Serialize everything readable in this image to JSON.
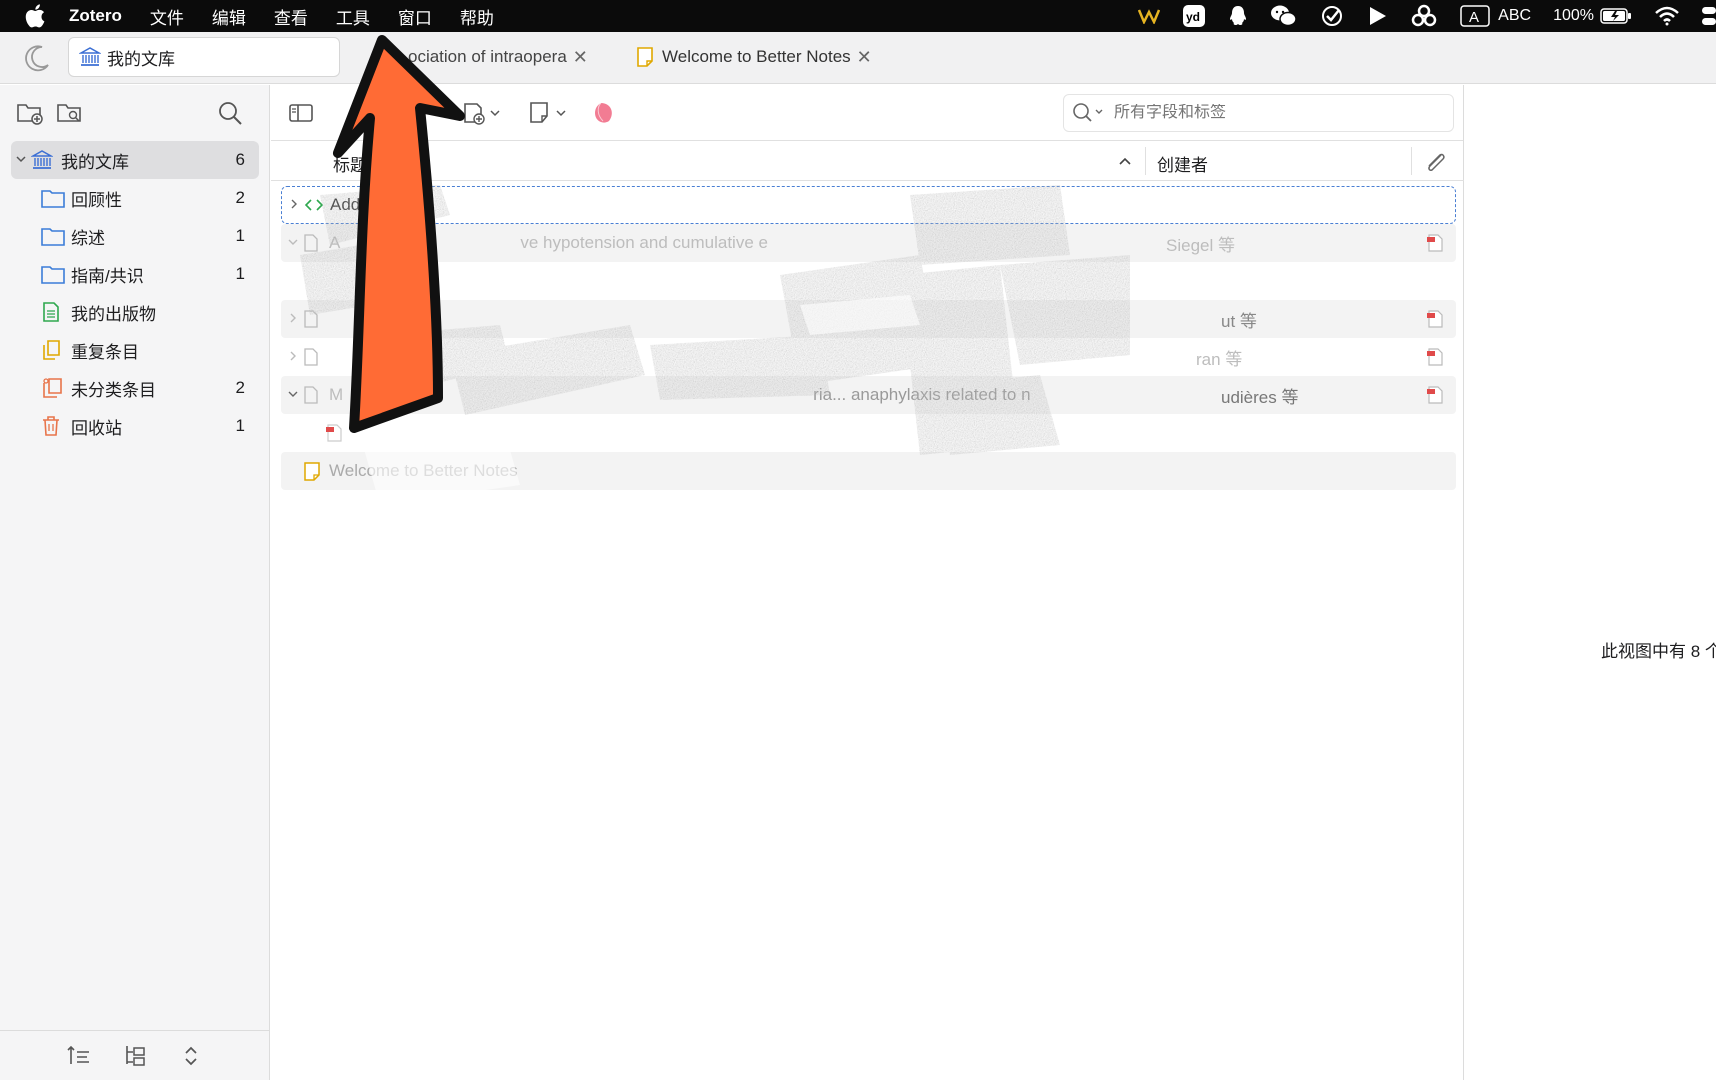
{
  "menubar": {
    "app_name": "Zotero",
    "menus": [
      "文件",
      "编辑",
      "查看",
      "工具",
      "窗口",
      "帮助"
    ],
    "input_source": "ABC",
    "battery": "100%"
  },
  "tabs": {
    "library_tab": "我的文库",
    "tab2": "ociation of intraopera",
    "tab3": "Welcome to Better Notes"
  },
  "sidebar": {
    "items": [
      {
        "label": "我的文库",
        "count": "6",
        "icon": "library-icon"
      },
      {
        "label": "回顾性",
        "count": "2",
        "icon": "folder-icon"
      },
      {
        "label": "综述",
        "count": "1",
        "icon": "folder-icon"
      },
      {
        "label": "指南/共识",
        "count": "1",
        "icon": "folder-icon"
      },
      {
        "label": "我的出版物",
        "count": "",
        "icon": "publications-icon"
      },
      {
        "label": "重复条目",
        "count": "",
        "icon": "duplicates-icon"
      },
      {
        "label": "未分类条目",
        "count": "2",
        "icon": "unfiled-icon"
      },
      {
        "label": "回收站",
        "count": "1",
        "icon": "trash-icon"
      }
    ]
  },
  "search": {
    "placeholder": "所有字段和标签"
  },
  "columns": {
    "title": "标题",
    "creator": "创建者"
  },
  "rows": [
    {
      "title": "Addo",
      "creator": ""
    },
    {
      "title": "A",
      "title_tail": "ve hypotension and cumulative e",
      "creator": "Siegel 等"
    },
    {
      "title": "",
      "creator": ""
    },
    {
      "title": "",
      "creator": "ut 等"
    },
    {
      "title": "",
      "creator": "ran 等"
    },
    {
      "title": "M",
      "title_tail": "ria... anaphylaxis related to n",
      "creator": "udières 等"
    },
    {
      "title": "",
      "creator": ""
    },
    {
      "title": "Welcome to Better Notes",
      "creator": ""
    }
  ],
  "status": {
    "count_text": "此视图中有 8 个"
  },
  "colors": {
    "arrow": "#FF6B35",
    "focus": "#4a7fd3"
  }
}
